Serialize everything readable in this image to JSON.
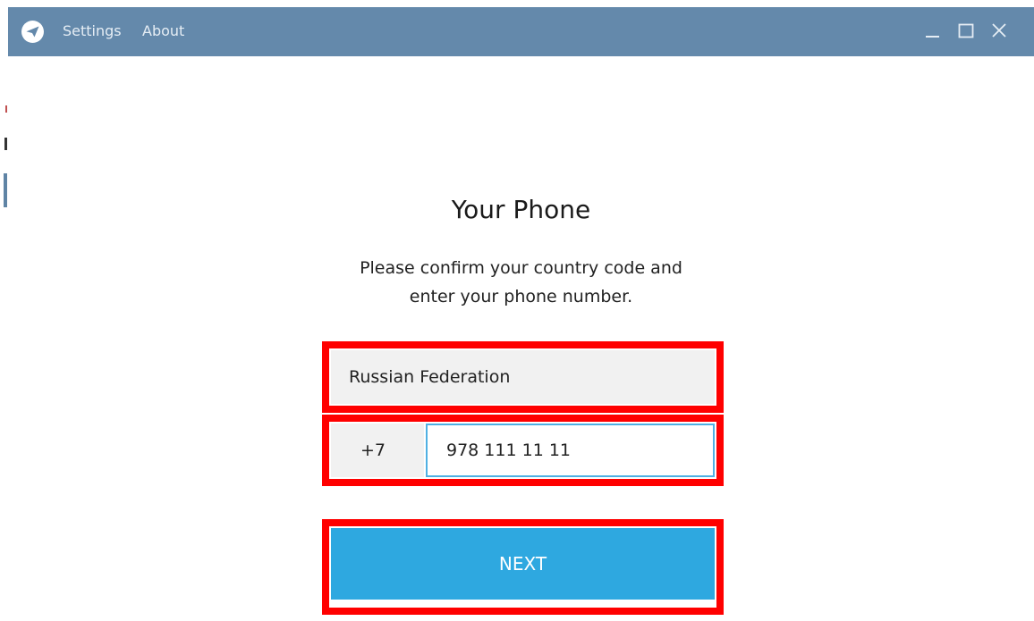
{
  "titlebar": {
    "menu": [
      "Settings",
      "About"
    ],
    "background_color": "#6489ab"
  },
  "content": {
    "title": "Your Phone",
    "subtitle_line1": "Please confirm your country code and",
    "subtitle_line2": "enter your phone number.",
    "country": "Russian Federation",
    "country_code": "+7",
    "phone_value": "978 111 11 11",
    "next_label": "NEXT",
    "accent_color": "#2ea8e0",
    "highlight_color": "#ff0000"
  },
  "icons": {
    "app_logo": "paper-plane-icon",
    "minimize": "minimize-icon",
    "maximize": "maximize-icon",
    "close": "close-icon"
  }
}
